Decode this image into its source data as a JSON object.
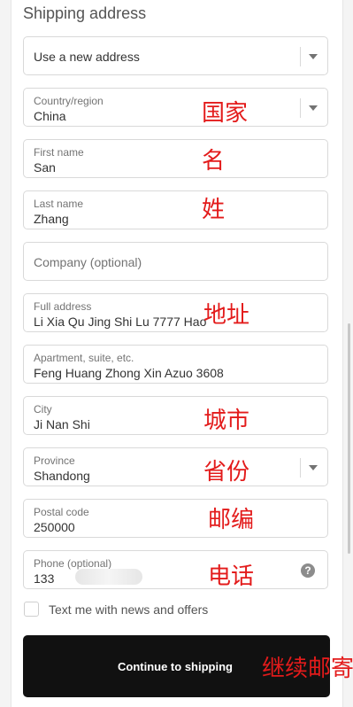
{
  "section_title": "Shipping address",
  "address_select": {
    "value": "Use a new address"
  },
  "country": {
    "label": "Country/region",
    "value": "China",
    "note": "国家"
  },
  "first_name": {
    "label": "First name",
    "value": "San",
    "note": "名"
  },
  "last_name": {
    "label": "Last name",
    "value": "Zhang",
    "note": "姓"
  },
  "company": {
    "placeholder": "Company (optional)"
  },
  "address": {
    "label": "Full address",
    "value": "Li Xia Qu Jing Shi Lu 7777 Hao",
    "note": "地址"
  },
  "apartment": {
    "label": "Apartment, suite, etc.",
    "value": "Feng Huang Zhong Xin Azuo 3608"
  },
  "city": {
    "label": "City",
    "value": "Ji Nan Shi",
    "note": "城市"
  },
  "province": {
    "label": "Province",
    "value": "Shandong",
    "note": "省份"
  },
  "postal_code": {
    "label": "Postal code",
    "value": "250000",
    "note": "邮编"
  },
  "phone": {
    "label": "Phone (optional)",
    "value": "133",
    "note": "电话",
    "help_glyph": "?"
  },
  "newsletter": {
    "label": "Text me with news and offers",
    "checked": false
  },
  "continue_button": {
    "label": "Continue to shipping",
    "note": "继续邮寄"
  }
}
